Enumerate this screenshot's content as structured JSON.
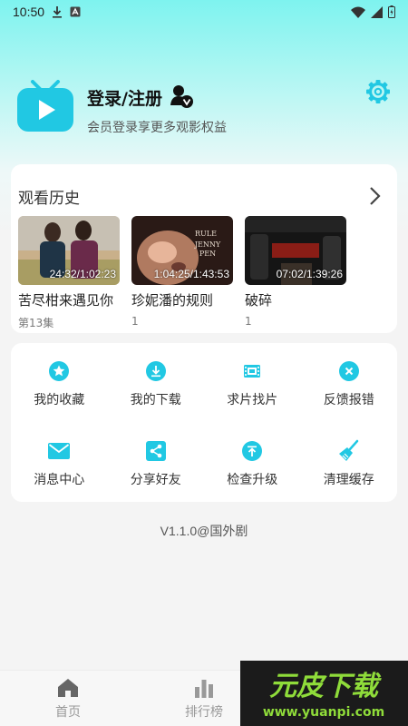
{
  "status_bar": {
    "time": "10:50"
  },
  "profile": {
    "login_label": "登录/注册",
    "subtitle": "会员登录享更多观影权益"
  },
  "history": {
    "title": "观看历史",
    "items": [
      {
        "time": "24:32/1:02:23",
        "title": "苦尽柑来遇见你",
        "sub": "第13集"
      },
      {
        "time": "1:04:25/1:43:53",
        "title": "珍妮潘的规则",
        "sub": "1"
      },
      {
        "time": "07:02/1:39:26",
        "title": "破碎",
        "sub": "1"
      }
    ]
  },
  "menu": {
    "items": [
      {
        "label": "我的收藏",
        "icon": "star-icon"
      },
      {
        "label": "我的下载",
        "icon": "download-icon"
      },
      {
        "label": "求片找片",
        "icon": "film-icon"
      },
      {
        "label": "反馈报错",
        "icon": "close-circle-icon"
      },
      {
        "label": "消息中心",
        "icon": "mail-icon"
      },
      {
        "label": "分享好友",
        "icon": "share-icon"
      },
      {
        "label": "检查升级",
        "icon": "upgrade-icon"
      },
      {
        "label": "清理缓存",
        "icon": "broom-icon"
      }
    ]
  },
  "version": "V1.1.0@国外剧",
  "bottom_nav": {
    "home": "首页",
    "ranking": "排行榜"
  },
  "watermark": {
    "brand": "元皮下载",
    "url": "www.yuanpi.com"
  },
  "colors": {
    "accent": "#21c8e3",
    "header_bg": "#7ef3ef",
    "page_bg": "#f4f4f4"
  }
}
